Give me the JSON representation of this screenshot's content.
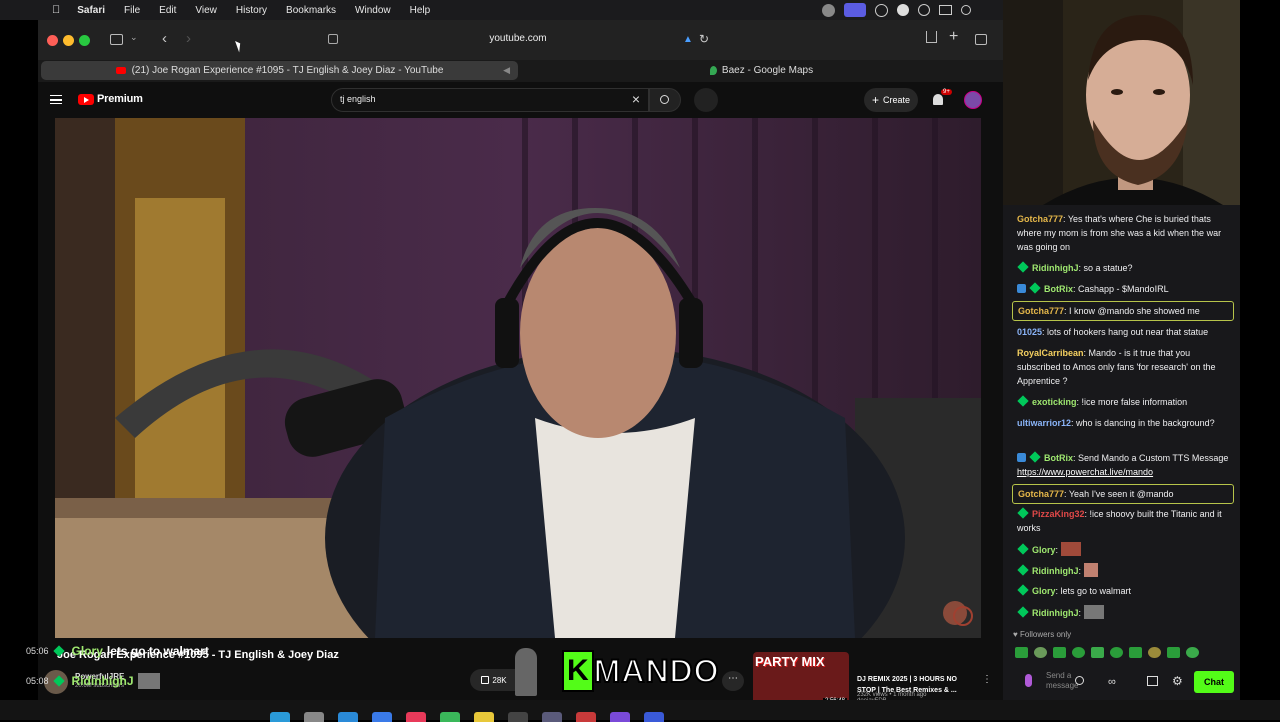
{
  "menubar": {
    "app": "Safari",
    "items": [
      "File",
      "Edit",
      "View",
      "History",
      "Bookmarks",
      "Window",
      "Help"
    ]
  },
  "browser": {
    "url": "youtube.com",
    "tabs": [
      {
        "title": "(21) Joe Rogan Experience #1095 - TJ English & Joey Diaz - YouTube",
        "active": true
      },
      {
        "title": "Baez - Google Maps",
        "active": false
      }
    ]
  },
  "youtube": {
    "logo": "Premium",
    "search_value": "tj english",
    "create_label": "Create",
    "notif_count": "9+",
    "video_title": "Joe Rogan Experience #1095 - TJ English & Joey Diaz",
    "channel_name": "PowerfulJRE",
    "subscribers": "20.6M subscribers",
    "likes": "28K",
    "sidebar_video": {
      "title": "DJ REMIX 2025 | 3 HOURS NO STOP | The Best Remixes & ...",
      "channel": "deejayFDB",
      "meta": "232K views • 1 month ago",
      "duration": "2:56:48",
      "thumb_text": "PARTY MIX"
    }
  },
  "stream_overlay": {
    "brand": "MANDO",
    "brand_k": "K",
    "chat_lines": [
      {
        "time": "05:06",
        "user": "Glory",
        "text": "lets go to walmart"
      },
      {
        "time": "05:08",
        "user": "RidinhighJ",
        "text": ""
      }
    ]
  },
  "chat": {
    "messages": [
      {
        "user": "Gotcha777",
        "text": "Yes that's where Che is buried thats where my mom is from she was a kid when the war was going on",
        "color": "#e6b84a",
        "highlight": false
      },
      {
        "user": "RidinhighJ",
        "text": "so a statue?",
        "color": "#9fe870",
        "gem": true
      },
      {
        "user": "BotRix",
        "text": "Cashapp - $MandoIRL",
        "color": "#9fe870",
        "bot": true
      },
      {
        "user": "Gotcha777",
        "text": "I know @mando she showed me",
        "color": "#e6b84a",
        "highlight": true
      },
      {
        "user": "01025",
        "text": "lots of hookers hang out near that statue",
        "color": "#8ab4f8"
      },
      {
        "user": "RoyalCarribean",
        "text": "Mando - is it true that you subscribed to Amos only fans 'for research' on the Apprentice ?",
        "color": "#f5d060"
      },
      {
        "user": "exoticking",
        "text": "!ice more false information",
        "color": "#9fe870",
        "gem": true
      },
      {
        "user": "ultiwarrior12",
        "text": "who is dancing in the background?",
        "color": "#8ab4f8"
      },
      {
        "user": "BotRix",
        "text": "Send Mando a Custom TTS Message",
        "link": "https://www.powerchat.live/mando",
        "color": "#9fe870",
        "bot": true
      },
      {
        "user": "Gotcha777",
        "text": "Yeah I've seen it @mando",
        "color": "#e6b84a",
        "highlight": true
      },
      {
        "user": "PizzaKing32",
        "text": "!ice shoovy built the Titanic and it works",
        "color": "#e04848",
        "gem": true
      },
      {
        "user": "Glory",
        "text": "",
        "color": "#9fe870",
        "gem": true,
        "emote": true
      },
      {
        "user": "RidinhighJ",
        "text": "",
        "color": "#9fe870",
        "gem": true,
        "emote": true
      },
      {
        "user": "Glory",
        "text": "lets go to walmart",
        "color": "#9fe870",
        "gem": true
      },
      {
        "user": "RidinhighJ",
        "text": "",
        "color": "#9fe870",
        "gem": true,
        "emote": true
      }
    ],
    "followers_only": "Followers only",
    "send_placeholder": "Send a message",
    "chat_button": "Chat"
  },
  "colors": {
    "chat_green": "#53fc18",
    "yt_red": "#ff0000",
    "safari_accent": "#5b5ce2"
  }
}
